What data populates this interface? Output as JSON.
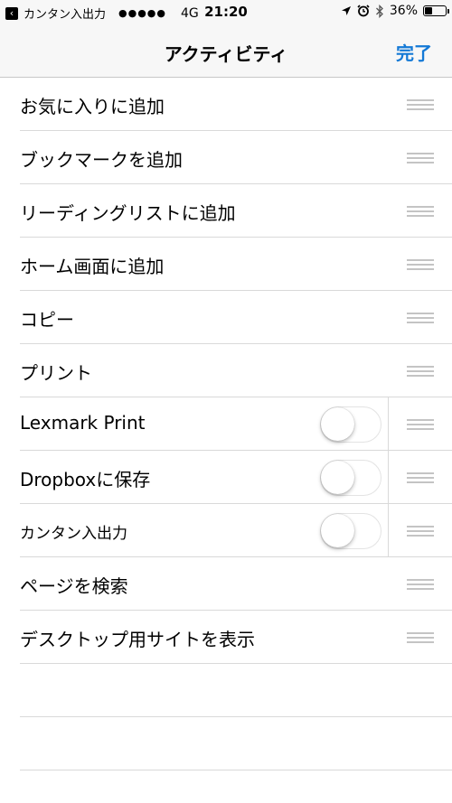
{
  "status_bar": {
    "back_app": "カンタン入出力",
    "signal": "●●●●●",
    "network": "4G",
    "time": "21:20",
    "battery": "36%",
    "battery_level": 0.36
  },
  "nav": {
    "title": "アクティビティ",
    "done": "完了",
    "accent_color": "#1479d6"
  },
  "activities": [
    {
      "label": "お気に入りに追加",
      "toggle": null
    },
    {
      "label": "ブックマークを追加",
      "toggle": null
    },
    {
      "label": "リーディングリストに追加",
      "toggle": null
    },
    {
      "label": "ホーム画面に追加",
      "toggle": null
    },
    {
      "label": "コピー",
      "toggle": null
    },
    {
      "label": "プリント",
      "toggle": null
    },
    {
      "label": "Lexmark Print",
      "toggle": false
    },
    {
      "label": "Dropboxに保存",
      "toggle": false
    },
    {
      "label": "カンタン入出力",
      "toggle": false
    },
    {
      "label": "ページを検索",
      "toggle": null
    },
    {
      "label": "デスクトップ用サイトを表示",
      "toggle": null
    }
  ]
}
